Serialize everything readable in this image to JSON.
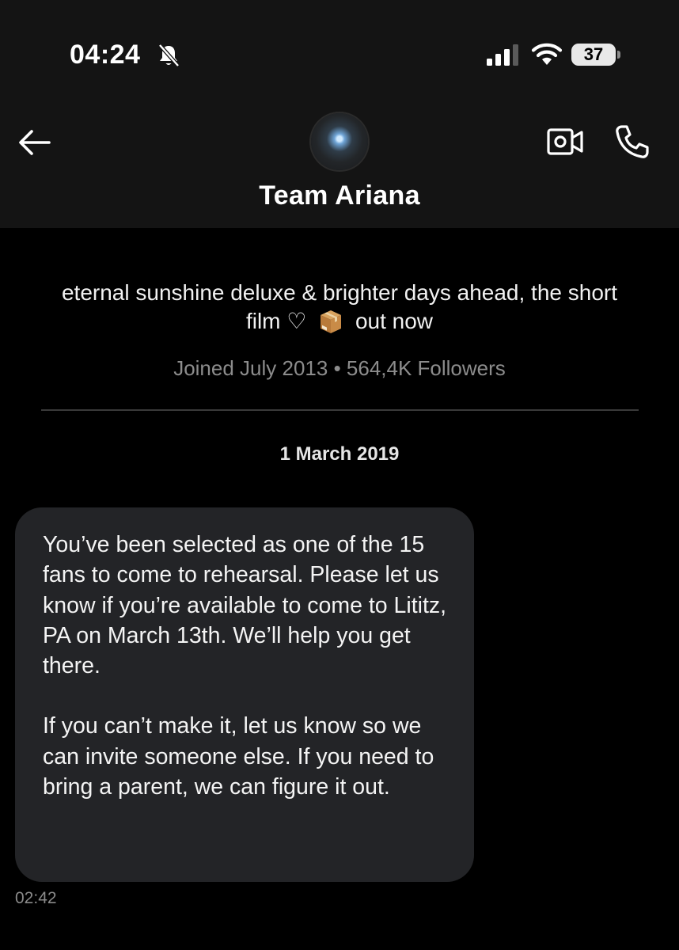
{
  "status_bar": {
    "time": "04:24",
    "battery": "37"
  },
  "header": {
    "title": "Team Ariana"
  },
  "profile": {
    "bio_part1": "eternal sunshine deluxe & brighter days ahead, the short film ♡",
    "bio_part2": "out now",
    "joined": "Joined July 2013",
    "separator": "•",
    "followers": "564,4K Followers"
  },
  "conversation": {
    "date": "1 March 2019",
    "messages": [
      {
        "paragraphs": [
          "You’ve been selected as one of the 15 fans to come to rehearsal. Please let us know if you’re available to come to Lititz, PA on March 13th. We’ll help you get there.",
          "If you can’t make it, let us know so we can invite someone else. If you need to bring a parent, we can figure it out."
        ],
        "time": "02:42"
      }
    ]
  },
  "icons": {
    "status": [
      "bell-slash-icon",
      "cellular-signal-icon",
      "wifi-icon",
      "battery-icon"
    ],
    "header": [
      "back-arrow-icon",
      "video-call-icon",
      "phone-icon"
    ],
    "emoji": "package-emoji"
  },
  "colors": {
    "background": "#000000",
    "header_background": "#141414",
    "bubble_background": "#232427",
    "muted_text": "#8c8c8c"
  }
}
